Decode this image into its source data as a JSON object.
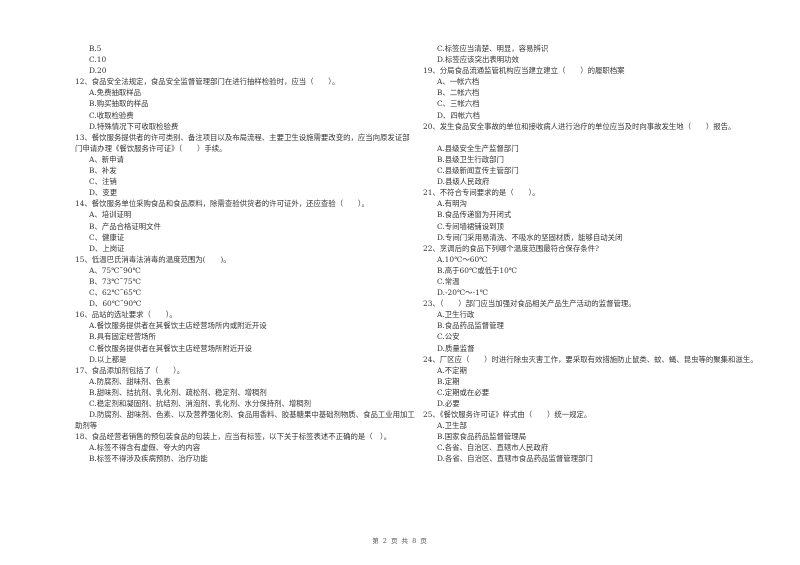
{
  "left_column": {
    "carry_options": [
      "B.5",
      "C.10",
      "D.20"
    ],
    "questions": [
      {
        "stem": "12、食品安全法规定，食品安全监督管理部门在进行抽样检验时，应当（　　）。",
        "options": [
          "A.免费抽取样品",
          "B.购买抽取的样品",
          "C.收取检验费",
          "D.特殊情况下可收取检验费"
        ]
      },
      {
        "stem": "13、餐饮服务提供者的许可类别、备注项目以及布局流程、主要卫生设施需要改变的，应当向原发证部门申请办理《餐饮服务许可证》（　　）手续。",
        "options": [
          "A、新申请",
          "B、补发",
          "C、注销",
          "D、变更"
        ]
      },
      {
        "stem": "14、餐饮服务单位采购食品和食品原料，除需查验供货者的许可证外，还应查验（　　）。",
        "options": [
          "A、培训证明",
          "B、产品合格证明文件",
          "C、健康证",
          "D、上岗证"
        ]
      },
      {
        "stem": "15、低温巴氏消毒法消毒的温度范围为(　　)。",
        "options": [
          "A、75℃˜90℃",
          "B、73℃˜75℃",
          "C、62℃˜65℃",
          "D、60℃˜90℃"
        ]
      },
      {
        "stem": "16、品站的选址要求（　　）。",
        "options": [
          "A.餐饮服务提供者在其餐饮主店经营场所内或附近开设",
          "B.具有固定经营场所",
          "C.餐饮服务提供者在其餐饮主店经营场所附近开设",
          "D.以上都是"
        ]
      },
      {
        "stem": "17、食品添加剂包括了（　　）。",
        "options": [
          "A.防腐剂、甜味剂、色素",
          "B.甜味剂、拮抗剂、乳化剂、疏松剂、稳定剂、增稠剂",
          "C.稳定剂和凝固剂、抗结剂、消泡剂、乳化剂、水分保持剂、增稠剂",
          "D.防腐剂、甜味剂、色素、以及营养强化剂、食品用香料、胶基糖果中基础剂物质、食品工业用加工助剂等"
        ]
      },
      {
        "stem": "18、食品经营者销售的预包装食品的包装上，应当有标签，以下关于标签表述不正确的是（　）。",
        "options": [
          "A.标签不得含有虚假、夸大的内容",
          "B.标签不得涉及疾病预防、治疗功能"
        ]
      }
    ]
  },
  "right_column": {
    "carry_options": [
      "C.标签应当清楚、明显，容易辨识",
      "D.标签应该突出表明功效"
    ],
    "questions": [
      {
        "stem": "19、分局食品流通监管机构应当建立建立（　　）的履职档案",
        "options": [
          "A、一帐六档",
          "B、二帐六档",
          "C、三帐六档",
          "D、四帐六档"
        ]
      },
      {
        "stem": "20、发生食品安全事故的单位和接收病人进行治疗的单位应当及时向事故发生地（　　）报告。",
        "options": [
          "A.县级安全生产监督部门",
          "B.县级卫生行政部门",
          "C.县级新闻宣传主管部门",
          "D.县级人民政府"
        ]
      },
      {
        "stem": "21、不符合专间要求的是（　　）。",
        "options": [
          "A.有明沟",
          "B.食品传递窗为开闭式",
          "C.专间墙裙铺设到顶",
          "D.专间门采用易清洗、不吸水的坚固材质，能够自动关闭"
        ]
      },
      {
        "stem": "22、烹调后的食品下列哪个温度范围最符合保存条件?",
        "options": [
          "A.10℃～60℃",
          "B.高于60℃或低于10℃",
          "C.常温",
          "D.-20℃～-1℃"
        ]
      },
      {
        "stem": "23、（　　）部门应当加强对食品相关产品生产活动的监督管理。",
        "options": [
          "A.卫生行政",
          "B.食品药品监督管理",
          "C.公安",
          "D.质量监督"
        ]
      },
      {
        "stem": "24、厂区应（　　）时进行除虫灭害工作，要采取有效措施防止鼠类、蚊、蝇、昆虫等的聚集和滋生。",
        "options": [
          "A.不定期",
          "B.定期",
          "C.定期或在必要",
          "D.必要"
        ]
      },
      {
        "stem": "25、《餐饮服务许可证》样式由（　　）统一规定。",
        "options": [
          "A.卫生部",
          "B.国家食品药品监督管理局",
          "C.各省、自治区、直辖市人民政府",
          "D.各省、自治区、直辖市食品药品监督管理部门"
        ]
      }
    ]
  },
  "footer": {
    "page_label": "第 2 页 共 8 页"
  }
}
